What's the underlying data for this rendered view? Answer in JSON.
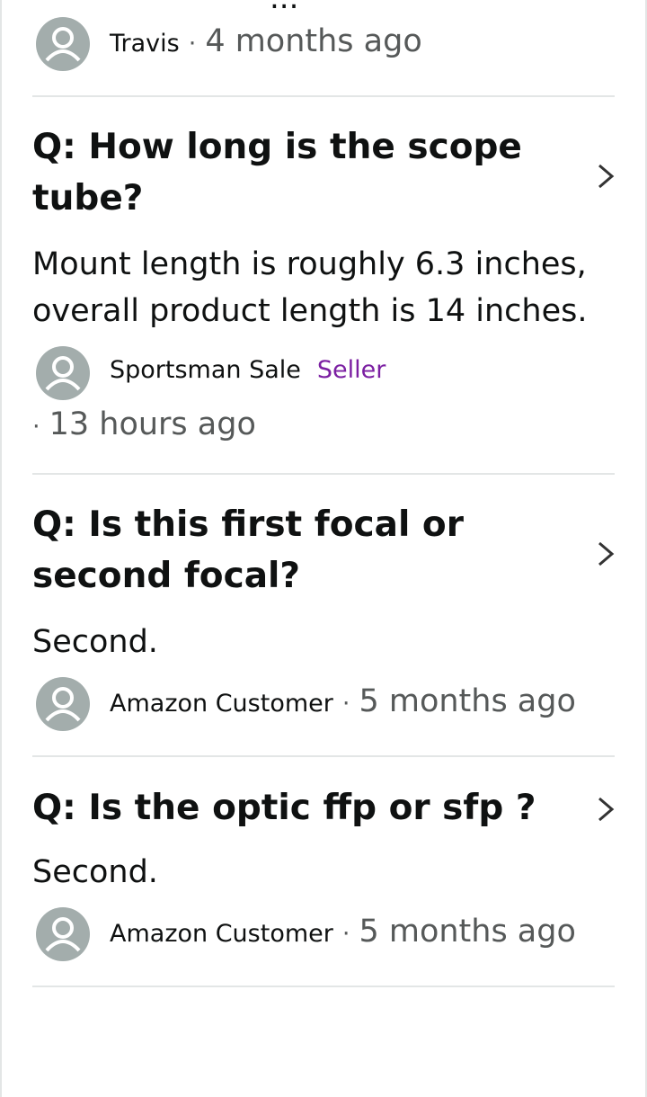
{
  "top": {
    "cutoff_text": "...",
    "author": "Travis",
    "separator": "·",
    "time": "4 months ago"
  },
  "qa": [
    {
      "question": "Q: How long is the scope tube?",
      "answer": "Mount length is roughly 6.3 inches, overall product length is 14 inches.",
      "author": "Sportsman Sale",
      "badge": "Seller",
      "separator": "·",
      "time": "13 hours ago"
    },
    {
      "question": "Q: Is this first focal or second focal?",
      "answer": "Second.",
      "author": "Amazon Customer",
      "separator": "·",
      "time": "5 months ago"
    },
    {
      "question": "Q: Is the optic ffp or sfp ?",
      "answer": "Second.",
      "author": "Amazon Customer",
      "separator": "·",
      "time": "5 months ago"
    }
  ],
  "icons": {
    "avatar": "user-avatar-icon",
    "chevron": "chevron-right-icon"
  },
  "colors": {
    "text": "#0f1111",
    "muted": "#565959",
    "seller": "#7b1fa2",
    "divider": "#e3e6e6",
    "avatar_bg": "#a3adac"
  }
}
